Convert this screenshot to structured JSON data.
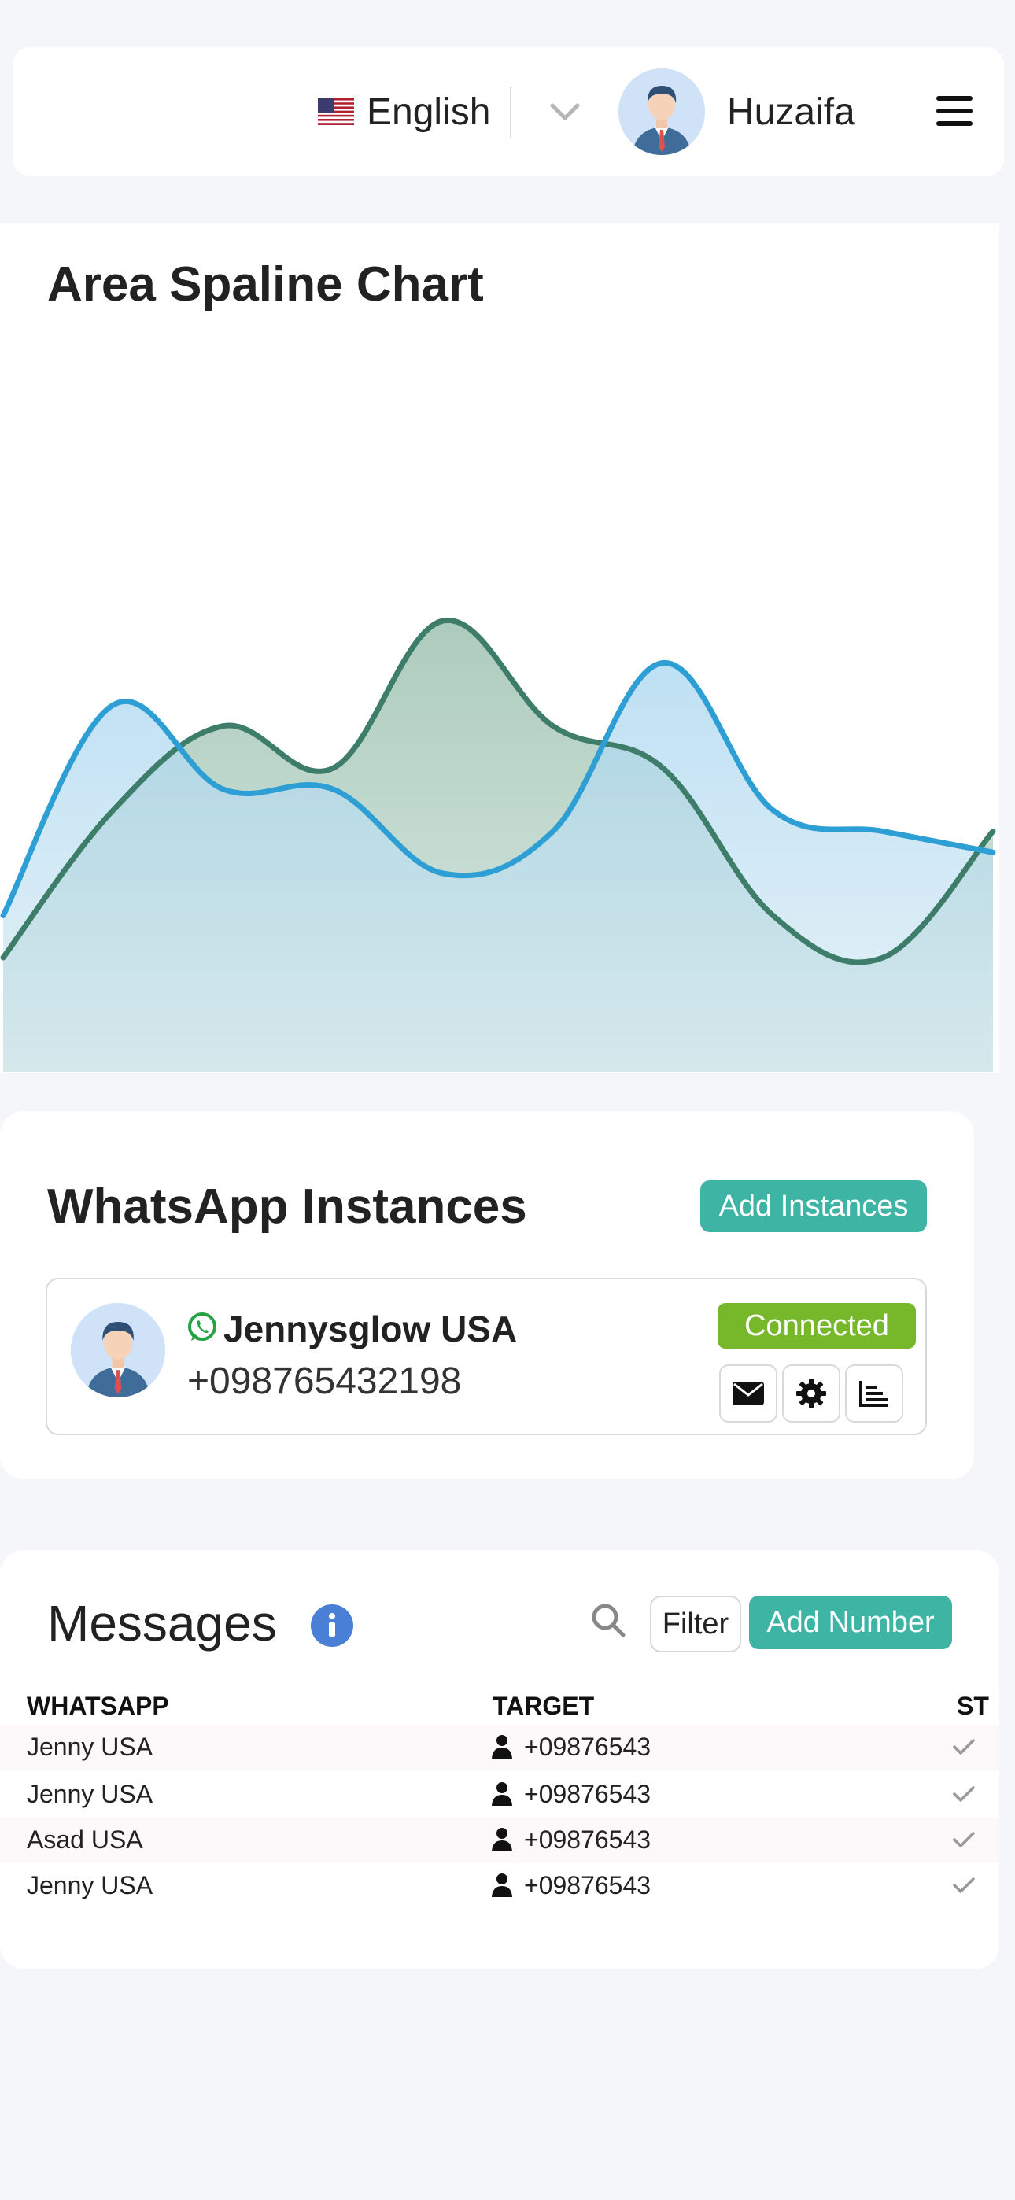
{
  "header": {
    "language": "English",
    "user_name": "Huzaifa"
  },
  "chart_data": {
    "type": "area",
    "title": "Area Spaline Chart",
    "xlabel": "",
    "ylabel": "",
    "x": [
      0,
      1,
      2,
      3,
      4,
      5,
      6,
      7,
      8,
      9
    ],
    "ylim": [
      0,
      100
    ],
    "series": [
      {
        "values": [
          20,
          55,
          75,
          65,
          100,
          75,
          65,
          30,
          20,
          50
        ],
        "color": "#3d7d6a",
        "fill": "#b5d2c5"
      },
      {
        "values": [
          30,
          80,
          60,
          60,
          40,
          50,
          90,
          55,
          50,
          45
        ],
        "color": "#2e9fd4",
        "fill": "#b8dcf1"
      }
    ],
    "grid": false
  },
  "instances": {
    "title": "WhatsApp Instances",
    "add_label": "Add Instances",
    "items": [
      {
        "name": "Jennysglow USA",
        "phone": "+098765432198",
        "status": "Connected"
      }
    ]
  },
  "messages": {
    "title": "Messages",
    "filter_label": "Filter",
    "add_label": "Add Number",
    "columns": [
      "WHATSAPP",
      "TARGET",
      "ST"
    ],
    "rows": [
      {
        "whatsapp": "Jenny USA",
        "target": "+09876543"
      },
      {
        "whatsapp": "Jenny USA",
        "target": "+09876543"
      },
      {
        "whatsapp": "Asad USA",
        "target": "+09876543"
      },
      {
        "whatsapp": "Jenny USA",
        "target": "+09876543"
      }
    ]
  }
}
